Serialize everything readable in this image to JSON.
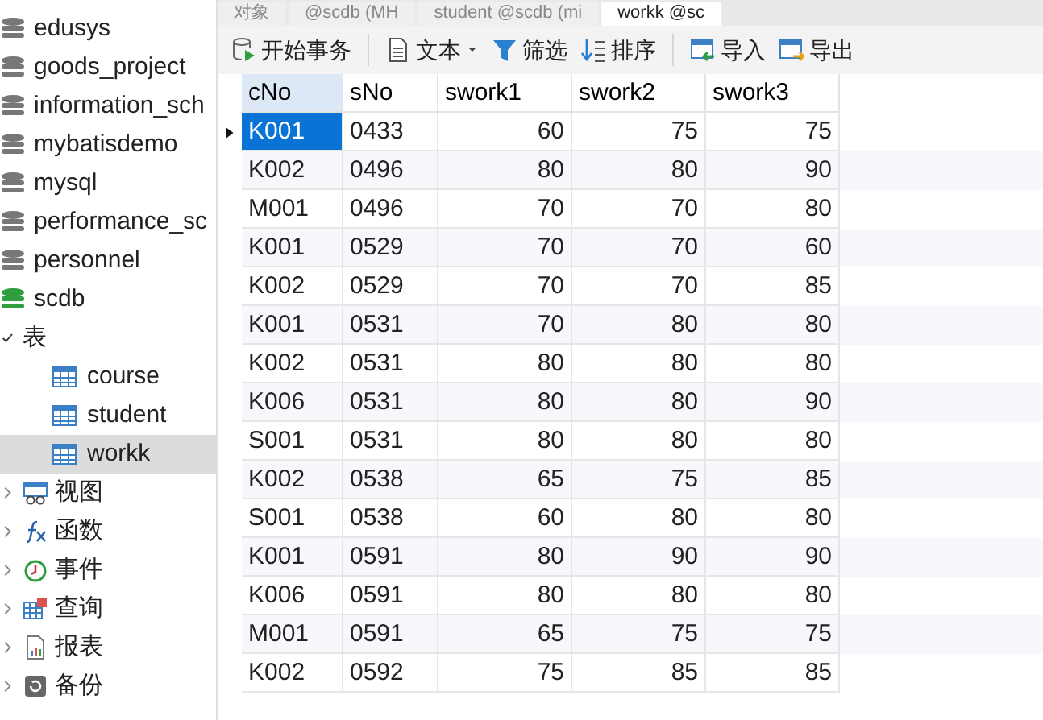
{
  "tabs": [
    {
      "label": "对象",
      "selected": false
    },
    {
      "label": "@scdb (MH",
      "selected": false
    },
    {
      "label": "student @scdb (mi",
      "selected": false
    },
    {
      "label": "workk @sc",
      "selected": true
    }
  ],
  "sidebar": {
    "items": [
      {
        "label": "edusys",
        "kind": "database",
        "active": false
      },
      {
        "label": "goods_project",
        "kind": "database",
        "active": false
      },
      {
        "label": "information_sch",
        "kind": "database",
        "active": false
      },
      {
        "label": "mybatisdemo",
        "kind": "database",
        "active": false
      },
      {
        "label": "mysql",
        "kind": "database",
        "active": false
      },
      {
        "label": "performance_sc",
        "kind": "database",
        "active": false
      },
      {
        "label": "personnel",
        "kind": "database",
        "active": false
      },
      {
        "label": "scdb",
        "kind": "database",
        "active": true,
        "children": [
          {
            "label": "表",
            "kind": "tables",
            "expanded": true,
            "children": [
              {
                "label": "course",
                "kind": "table",
                "selected": false
              },
              {
                "label": "student",
                "kind": "table",
                "selected": false
              },
              {
                "label": "workk",
                "kind": "table",
                "selected": true
              }
            ]
          },
          {
            "label": "视图",
            "kind": "views",
            "expanded": false
          },
          {
            "label": "函数",
            "kind": "functions",
            "expanded": false
          },
          {
            "label": "事件",
            "kind": "events",
            "expanded": false
          },
          {
            "label": "查询",
            "kind": "queries",
            "expanded": false
          },
          {
            "label": "报表",
            "kind": "reports",
            "expanded": false
          },
          {
            "label": "备份",
            "kind": "backups",
            "expanded": false
          }
        ]
      }
    ]
  },
  "toolbar": [
    {
      "label": "开始事务",
      "kind": "transaction"
    },
    {
      "label": "文本",
      "kind": "text"
    },
    {
      "label": "筛选",
      "kind": "filter"
    },
    {
      "label": "排序",
      "kind": "sort"
    },
    {
      "label": "导入",
      "kind": "import"
    },
    {
      "label": "导出",
      "kind": "export"
    }
  ],
  "table": {
    "columns": [
      "cNo",
      "sNo",
      "swork1",
      "swork2",
      "swork3"
    ],
    "rows": [
      {
        "cells": [
          "K001",
          "0433",
          "60",
          "75",
          "75"
        ],
        "selected": true
      },
      {
        "cells": [
          "K002",
          "0496",
          "80",
          "80",
          "90"
        ],
        "selected": false
      },
      {
        "cells": [
          "M001",
          "0496",
          "70",
          "70",
          "80"
        ],
        "selected": false
      },
      {
        "cells": [
          "K001",
          "0529",
          "70",
          "70",
          "60"
        ],
        "selected": false
      },
      {
        "cells": [
          "K002",
          "0529",
          "70",
          "70",
          "85"
        ],
        "selected": false
      },
      {
        "cells": [
          "K001",
          "0531",
          "70",
          "80",
          "80"
        ],
        "selected": false
      },
      {
        "cells": [
          "K002",
          "0531",
          "80",
          "80",
          "80"
        ],
        "selected": false
      },
      {
        "cells": [
          "K006",
          "0531",
          "80",
          "80",
          "90"
        ],
        "selected": false
      },
      {
        "cells": [
          "S001",
          "0531",
          "80",
          "80",
          "80"
        ],
        "selected": false
      },
      {
        "cells": [
          "K002",
          "0538",
          "65",
          "75",
          "85"
        ],
        "selected": false
      },
      {
        "cells": [
          "S001",
          "0538",
          "60",
          "80",
          "80"
        ],
        "selected": false
      },
      {
        "cells": [
          "K001",
          "0591",
          "80",
          "90",
          "90"
        ],
        "selected": false
      },
      {
        "cells": [
          "K006",
          "0591",
          "80",
          "80",
          "80"
        ],
        "selected": false
      },
      {
        "cells": [
          "M001",
          "0591",
          "65",
          "75",
          "75"
        ],
        "selected": false
      },
      {
        "cells": [
          "K002",
          "0592",
          "75",
          "85",
          "85"
        ],
        "selected": false
      }
    ]
  }
}
